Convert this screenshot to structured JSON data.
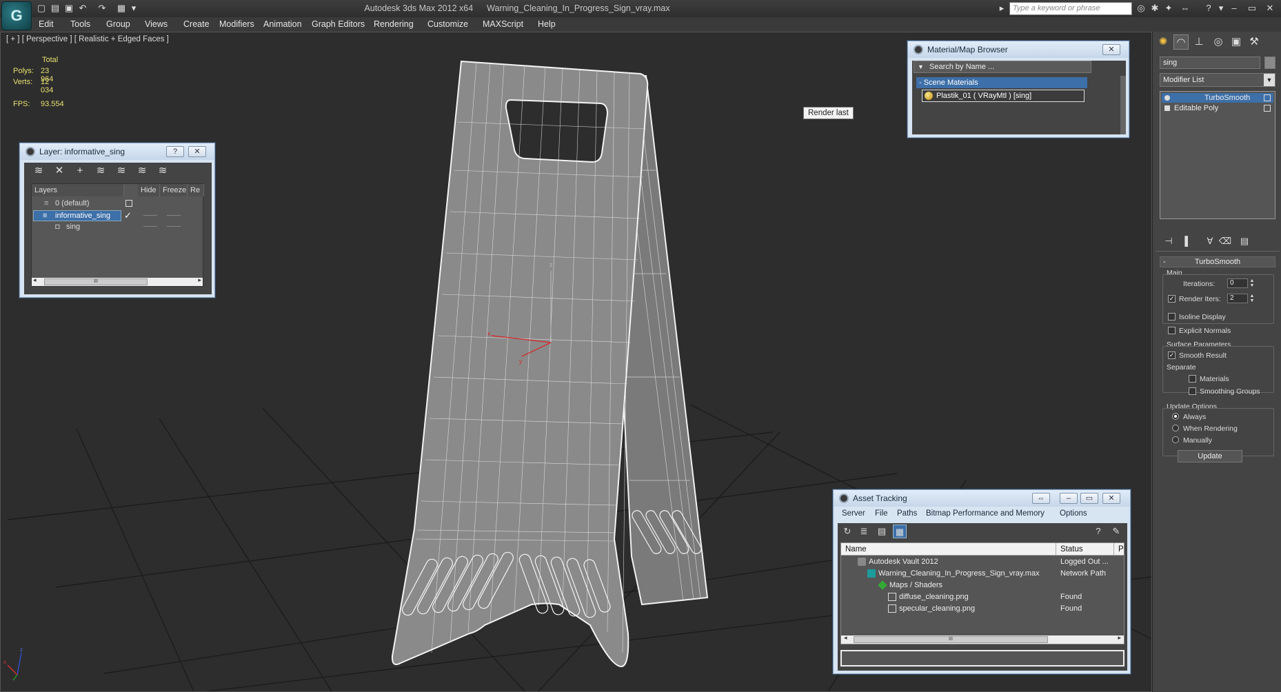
{
  "app": {
    "title": "Autodesk 3ds Max  2012 x64",
    "file": "Warning_Cleaning_In_Progress_Sign_vray.max",
    "search_placeholder": "Type a keyword or phrase"
  },
  "menu": [
    "Edit",
    "Tools",
    "Group",
    "Views",
    "Create",
    "Modifiers",
    "Animation",
    "Graph Editors",
    "Rendering",
    "Customize",
    "MAXScript",
    "Help"
  ],
  "viewport": {
    "label": "[ + ] [ Perspective ] [ Realistic + Edged Faces ]",
    "stats": {
      "total_label": "Total",
      "polys_label": "Polys:",
      "polys": "23 964",
      "verts_label": "Verts:",
      "verts": "12 034",
      "fps_label": "FPS:",
      "fps": "93.554"
    },
    "tooltip": "Render last",
    "axis": {
      "x": "x",
      "y": "y",
      "z": "z"
    }
  },
  "layer_dialog": {
    "title": "Layer: informative_sing",
    "help": "?",
    "close": "✕",
    "columns": [
      "Layers",
      "Hide",
      "Freeze",
      "Re"
    ],
    "rows": [
      {
        "name": "0 (default)"
      },
      {
        "name": "informative_sing"
      },
      {
        "name": "sing"
      }
    ],
    "scroll_grip": "III"
  },
  "material_browser": {
    "title": "Material/Map Browser",
    "close": "✕",
    "search": "Search by Name ...",
    "group": "- Scene Materials",
    "item": "Plastik_01  ( VRayMtl )  [sing]"
  },
  "asset_tracking": {
    "title": "Asset Tracking",
    "menu": [
      "Server",
      "File",
      "Paths",
      "Bitmap Performance and Memory",
      "Options"
    ],
    "columns": [
      "Name",
      "Status",
      "P"
    ],
    "rows": [
      {
        "name": "Autodesk Vault 2012",
        "status": "Logged Out ..."
      },
      {
        "name": "Warning_Cleaning_In_Progress_Sign_vray.max",
        "status": "Network Path"
      },
      {
        "name": "Maps / Shaders",
        "status": ""
      },
      {
        "name": "diffuse_cleaning.png",
        "status": "Found"
      },
      {
        "name": "specular_cleaning.png",
        "status": "Found"
      }
    ],
    "scroll_grip": "III"
  },
  "command_panel": {
    "object_name": "sing",
    "modifier_list": "Modifier List",
    "stack": [
      "TurboSmooth",
      "Editable Poly"
    ],
    "rollout": "TurboSmooth",
    "main_label": "Main",
    "iterations_label": "Iterations:",
    "iterations": "0",
    "render_iters_label": "Render Iters:",
    "render_iters": "2",
    "isoline": "Isoline Display",
    "explicit": "Explicit Normals",
    "surface_label": "Surface Parameters",
    "smooth_result": "Smooth Result",
    "separate_label": "Separate",
    "materials": "Materials",
    "smoothing_groups": "Smoothing Groups",
    "update_label": "Update Options",
    "always": "Always",
    "when_rendering": "When Rendering",
    "manually": "Manually",
    "update_btn": "Update"
  },
  "colors": {
    "selection": "#3d6fa8",
    "stats": "#e8e070",
    "axis_x": "#d03030",
    "axis_y": "#2a9a2a",
    "axis_z": "#3050d0"
  }
}
